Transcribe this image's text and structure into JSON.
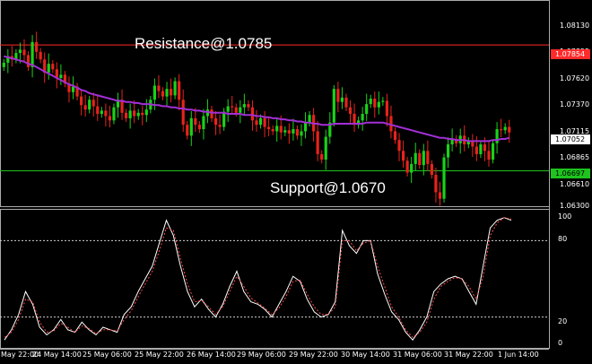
{
  "chart_data": [
    {
      "type": "candlestick",
      "annotations": [
        {
          "text": "Resistance@1.0785",
          "level": 1.07854,
          "color": "#ff2a2a"
        },
        {
          "text": "Support@1.0670",
          "level": 1.06697,
          "color": "#1ec31e"
        }
      ],
      "price_tags": {
        "resistance": "1.07854",
        "current": "1.07052",
        "support": "1.06697"
      },
      "y_ticks": [
        "1.08130",
        "1.07855",
        "1.07620",
        "1.07370",
        "1.07115",
        "1.06865",
        "1.06610",
        "1.06300"
      ],
      "ylim": [
        1.0638,
        1.0825
      ],
      "close": [
        1.0769,
        1.0775,
        1.0772,
        1.0778,
        1.0781,
        1.0776,
        1.0765,
        1.0788,
        1.0779,
        1.0772,
        1.076,
        1.0768,
        1.0763,
        1.0755,
        1.0758,
        1.075,
        1.0742,
        1.0747,
        1.0738,
        1.073,
        1.0726,
        1.0735,
        1.0729,
        1.0722,
        1.0725,
        1.072,
        1.0716,
        1.0728,
        1.0735,
        1.0723,
        1.0718,
        1.0725,
        1.072,
        1.0723,
        1.0721,
        1.0726,
        1.0735,
        1.0748,
        1.0743,
        1.0738,
        1.0745,
        1.0739,
        1.0752,
        1.0735,
        1.0712,
        1.0702,
        1.0718,
        1.0712,
        1.0708,
        1.072,
        1.0726,
        1.0718,
        1.0712,
        1.071,
        1.0724,
        1.0729,
        1.0728,
        1.0723,
        1.0728,
        1.0731,
        1.0728,
        1.0716,
        1.0712,
        1.0718,
        1.071,
        1.0708,
        1.0706,
        1.0711,
        1.0705,
        1.0707,
        1.0704,
        1.0708,
        1.0702,
        1.0706,
        1.0714,
        1.0721,
        1.0706,
        1.0685,
        1.068,
        1.0701,
        1.0714,
        1.0745,
        1.0733,
        1.0737,
        1.0728,
        1.0722,
        1.0712,
        1.0716,
        1.0722,
        1.0731,
        1.0736,
        1.0728,
        1.0733,
        1.0734,
        1.072,
        1.0706,
        1.0698,
        1.0688,
        1.0679,
        1.0668,
        1.0676,
        1.0686,
        1.0675,
        1.0688,
        1.0676,
        1.0666,
        1.065,
        1.0644,
        1.0682,
        1.0694,
        1.0699,
        1.0695,
        1.0702,
        1.0694,
        1.0697,
        1.0692,
        1.0685,
        1.0694,
        1.0688,
        1.068,
        1.0695,
        1.0708,
        1.0707,
        1.071,
        1.0705
      ],
      "ma": [
        1.0775,
        1.0774,
        1.0773,
        1.0772,
        1.0771,
        1.077,
        1.0768,
        1.0767,
        1.0765,
        1.0763,
        1.0761,
        1.0759,
        1.0757,
        1.0755,
        1.0753,
        1.0751,
        1.0749,
        1.0748,
        1.0746,
        1.0744,
        1.0743,
        1.0741,
        1.074,
        1.0739,
        1.0738,
        1.0737,
        1.0736,
        1.0735,
        1.0734,
        1.0734,
        1.0733,
        1.0733,
        1.0732,
        1.0732,
        1.0731,
        1.0731,
        1.0731,
        1.073,
        1.073,
        1.0729,
        1.0729,
        1.0728,
        1.0728,
        1.0727,
        1.0727,
        1.0726,
        1.0726,
        1.0725,
        1.0725,
        1.0724,
        1.0724,
        1.0723,
        1.0723,
        1.0723,
        1.0723,
        1.0722,
        1.0722,
        1.0722,
        1.0722,
        1.0721,
        1.0721,
        1.0721,
        1.072,
        1.072,
        1.0719,
        1.0719,
        1.0718,
        1.0718,
        1.0717,
        1.0717,
        1.0716,
        1.0716,
        1.0715,
        1.0715,
        1.0714,
        1.0714,
        1.0713,
        1.0713,
        1.0712,
        1.0712,
        1.0712,
        1.0713,
        1.0713,
        1.0713,
        1.0713,
        1.0713,
        1.0713,
        1.0713,
        1.0713,
        1.0714,
        1.0714,
        1.0714,
        1.0714,
        1.0714,
        1.0713,
        1.0712,
        1.0711,
        1.071,
        1.0709,
        1.0708,
        1.0707,
        1.0706,
        1.0705,
        1.0704,
        1.0703,
        1.0702,
        1.0701,
        1.07,
        1.07,
        1.0699,
        1.0699,
        1.0698,
        1.0698,
        1.0698,
        1.0697,
        1.0697,
        1.0697,
        1.0697,
        1.0697,
        1.0697,
        1.0698,
        1.0698,
        1.0699,
        1.0699,
        1.07
      ],
      "colors": {
        "bull": "#19d219",
        "bear": "#e8231b",
        "ma": "#a22fd6",
        "resistance": "#ff2a2a",
        "support": "#1ec31e"
      }
    },
    {
      "type": "line",
      "y_ticks": [
        "100",
        "80",
        "20",
        "0"
      ],
      "ylim": [
        0,
        100
      ],
      "levels": [
        80,
        20
      ],
      "x_labels": [
        "May 22:00",
        "24 May 14:00",
        "25 May 06:00",
        "25 May 22:00",
        "26 May 14:00",
        "29 May 06:00",
        "29 May 22:00",
        "30 May 14:00",
        "31 May 06:00",
        "31 May 22:00",
        "1 Jun 14:00"
      ],
      "series": [
        {
          "color": "#ffffff",
          "dashed": false,
          "values": [
            2,
            10,
            22,
            40,
            30,
            12,
            6,
            10,
            18,
            10,
            8,
            16,
            10,
            6,
            12,
            10,
            8,
            22,
            28,
            40,
            50,
            60,
            78,
            96,
            84,
            60,
            40,
            28,
            34,
            26,
            20,
            30,
            44,
            56,
            40,
            32,
            30,
            26,
            20,
            30,
            40,
            52,
            48,
            34,
            24,
            20,
            22,
            32,
            88,
            76,
            70,
            80,
            80,
            54,
            38,
            24,
            18,
            8,
            2,
            10,
            20,
            40,
            46,
            50,
            52,
            50,
            40,
            30,
            60,
            90,
            96,
            98,
            96
          ]
        },
        {
          "color": "#ff4a4a",
          "dashed": true,
          "values": [
            4,
            8,
            18,
            34,
            32,
            16,
            8,
            9,
            15,
            12,
            8,
            13,
            11,
            7,
            10,
            10,
            9,
            18,
            25,
            36,
            46,
            56,
            72,
            90,
            88,
            66,
            46,
            32,
            33,
            28,
            22,
            28,
            40,
            52,
            44,
            35,
            31,
            27,
            22,
            27,
            36,
            48,
            49,
            38,
            28,
            22,
            22,
            28,
            80,
            80,
            72,
            78,
            80,
            60,
            44,
            28,
            20,
            10,
            4,
            8,
            16,
            34,
            44,
            48,
            51,
            50,
            44,
            34,
            52,
            84,
            94,
            98,
            97
          ]
        }
      ]
    }
  ]
}
